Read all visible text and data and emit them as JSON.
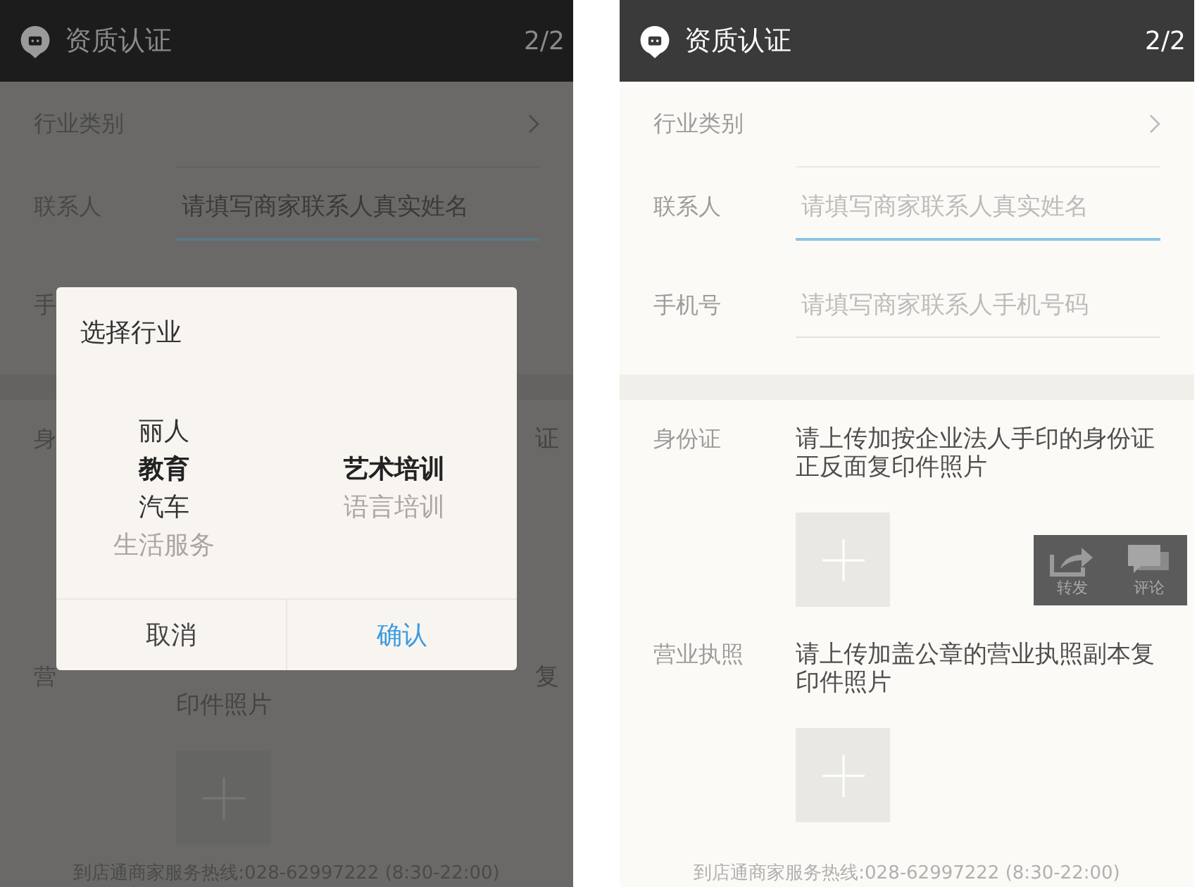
{
  "left_screen": {
    "header": {
      "title": "资质认证",
      "page": "2/2"
    },
    "category_label": "行业类别",
    "contact": {
      "label": "联系人",
      "placeholder": "请填写商家联系人真实姓名",
      "focused": true
    },
    "phone_label": "手",
    "id_row": {
      "label": "身",
      "tail": "证"
    },
    "license_row": {
      "label": "营",
      "tail": "复",
      "line_2": "印件照片"
    },
    "footer": "到店通商家服务热线:028-62997222 (8:30-22:00)",
    "dialog": {
      "title": "选择行业",
      "columns": [
        [
          {
            "label": "丽人",
            "selected": false,
            "faded": false
          },
          {
            "label": "教育",
            "selected": true,
            "faded": false
          },
          {
            "label": "汽车",
            "selected": false,
            "faded": false
          },
          {
            "label": "生活服务",
            "selected": false,
            "faded": true
          }
        ],
        [
          {
            "label": "艺术培训",
            "selected": true,
            "faded": false
          },
          {
            "label": "语言培训",
            "selected": false,
            "faded": true
          }
        ]
      ],
      "buttons": [
        {
          "label": "取消",
          "kind": "cancel"
        },
        {
          "label": "确认",
          "kind": "confirm"
        }
      ]
    }
  },
  "right_screen": {
    "header": {
      "title": "资质认证",
      "page": "2/2"
    },
    "rows": [
      {
        "kind": "select",
        "label": "行业类别"
      },
      {
        "kind": "input",
        "label": "联系人",
        "placeholder": "请填写商家联系人真实姓名",
        "focused": true
      },
      {
        "kind": "input",
        "label": "手机号",
        "placeholder": "请填写商家联系人手机号码",
        "focused": false
      },
      {
        "kind": "upload",
        "label": "身份证",
        "lines": [
          "请上传加按企业法人手印的身份证",
          "正反面复印件照片"
        ]
      },
      {
        "kind": "upload",
        "label": "营业执照",
        "lines": [
          "请上传加盖公章的营业执照副本复",
          "印件照片"
        ]
      }
    ],
    "footer": "到店通商家服务热线:028-62997222 (8:30-22:00)"
  },
  "share_panel": {
    "actions": [
      {
        "kind": "share",
        "label": "转发"
      },
      {
        "kind": "comment",
        "label": "评论"
      }
    ]
  }
}
